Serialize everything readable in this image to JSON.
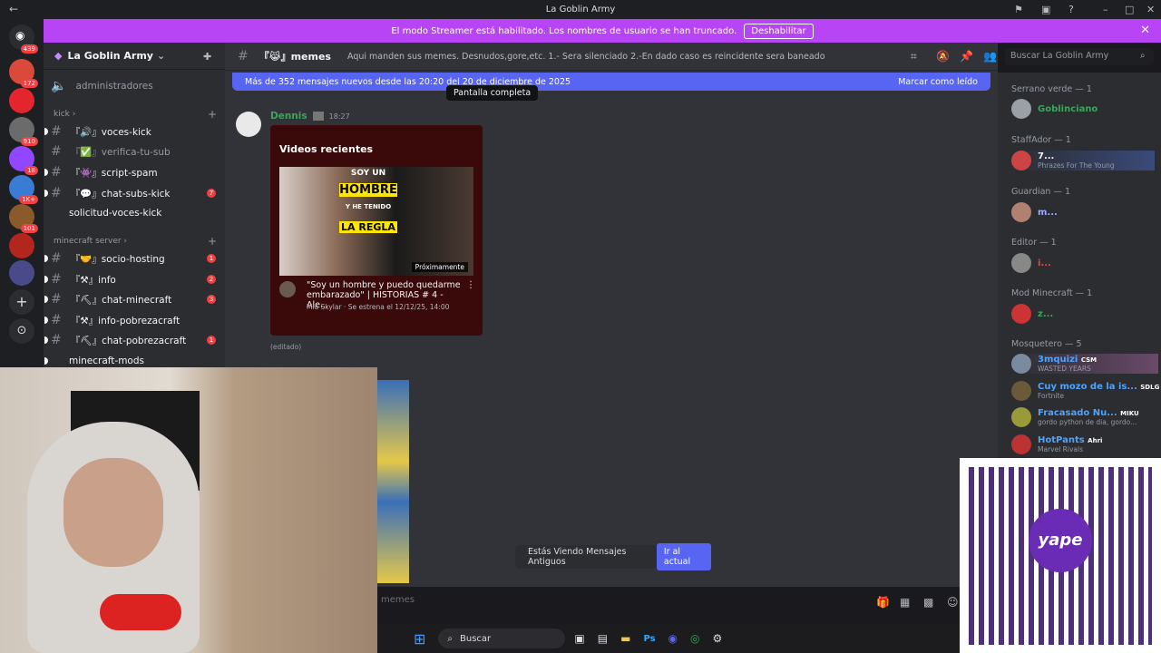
{
  "window": {
    "title": "La Goblin Army"
  },
  "streamer_bar": {
    "text": "El modo Streamer está habilitado. Los nombres de usuario se han truncado.",
    "button": "Deshabilitar"
  },
  "guild_badges": [
    "439",
    "172",
    "910",
    "18",
    "1K+",
    "101"
  ],
  "server": {
    "name": "La Goblin Army"
  },
  "sidebar": {
    "top_item": "administradores",
    "categories": [
      {
        "name": "kick",
        "channels": [
          {
            "label": "『🔊』voces-kick",
            "count": ""
          },
          {
            "label": "『✅』verifica-tu-sub",
            "count": ""
          },
          {
            "label": "『👾』script-spam",
            "count": ""
          },
          {
            "label": "『💬』chat-subs-kick",
            "count": "7"
          },
          {
            "label": "solicitud-voces-kick",
            "count": ""
          }
        ]
      },
      {
        "name": "minecraft server",
        "channels": [
          {
            "label": "『🤝』socio-hosting",
            "count": "1"
          },
          {
            "label": "『⚒』info",
            "count": "2"
          },
          {
            "label": "『⛏』chat-minecraft",
            "count": "3"
          },
          {
            "label": "『⚒』info-pobrezacraft",
            "count": ""
          },
          {
            "label": "『⛏』chat-pobrezacraft",
            "count": "1"
          },
          {
            "label": "minecraft-mods",
            "count": ""
          }
        ]
      }
    ]
  },
  "channel_header": {
    "name": "『😹』memes",
    "topic": "Aqui manden sus memes. Desnudos,gore,etc. 1.- Sera silenciado 2.-En dado caso es reincidente sera baneado"
  },
  "search": {
    "placeholder": "Buscar La Goblin Army"
  },
  "new_messages": {
    "text": "Más de 352 mensajes nuevos desde las 20:20 del 20 de diciembre de 2025",
    "action": "Marcar como leído"
  },
  "tooltip": "Pantalla completa",
  "message": {
    "author": "Dennis",
    "time": "18:27",
    "edited": "(editado)",
    "embed": {
      "heading": "Videos recientes",
      "thumb_lines": [
        "SOY UN",
        "HOMBRE",
        "Y HE TENIDO",
        "LA REGLA"
      ],
      "badge": "Próximamente",
      "video_title": "\"Soy un hombre y puedo quedarme embarazado\" | HISTORIAS # 4 - Ale...",
      "channel_line": "Mia Skylar · Se estrena el 12/12/25, 14:00"
    }
  },
  "old_messages_notice": {
    "text": "Estás Viendo Mensajes Antiguos",
    "button": "Ir al actual"
  },
  "composer": {
    "placeholder": "memes"
  },
  "members": {
    "groups": [
      {
        "name": "Serrano verde — 1",
        "members": [
          {
            "name": "Goblinciano",
            "sub": "",
            "color": "#3ba55d"
          }
        ]
      },
      {
        "name": "StaffAdor — 1",
        "members": [
          {
            "name": "7...",
            "sub": "Phrazes For The Young",
            "color": "#f2f3f5"
          }
        ]
      },
      {
        "name": "Guardian — 1",
        "members": [
          {
            "name": "m...",
            "sub": "",
            "color": "#a0a8ff"
          }
        ]
      },
      {
        "name": "Editor — 1",
        "members": [
          {
            "name": "i...",
            "sub": "",
            "color": "#f23f42"
          }
        ]
      },
      {
        "name": "Mod Minecraft — 1",
        "members": [
          {
            "name": "z...",
            "sub": "",
            "color": "#3ba55d"
          }
        ]
      },
      {
        "name": "Mosquetero — 5",
        "members": [
          {
            "name": "3mquizi",
            "tag": "CSM",
            "sub": "WASTED YEARS",
            "color": "#4ea3ff"
          },
          {
            "name": "Cuy mozo de la is...",
            "tag": "SDLG",
            "sub": "Fortnite",
            "color": "#4ea3ff"
          },
          {
            "name": "Fracasado Nu...",
            "tag": "MIKU",
            "sub": "gordo python de dia, gordo...",
            "color": "#4ea3ff"
          },
          {
            "name": "HotPants",
            "tag": "Ahri",
            "sub": "Marvel Rivals",
            "color": "#4ea3ff"
          }
        ]
      }
    ]
  },
  "qr": {
    "brand": "yape"
  },
  "taskbar": {
    "search_label": "Buscar"
  }
}
